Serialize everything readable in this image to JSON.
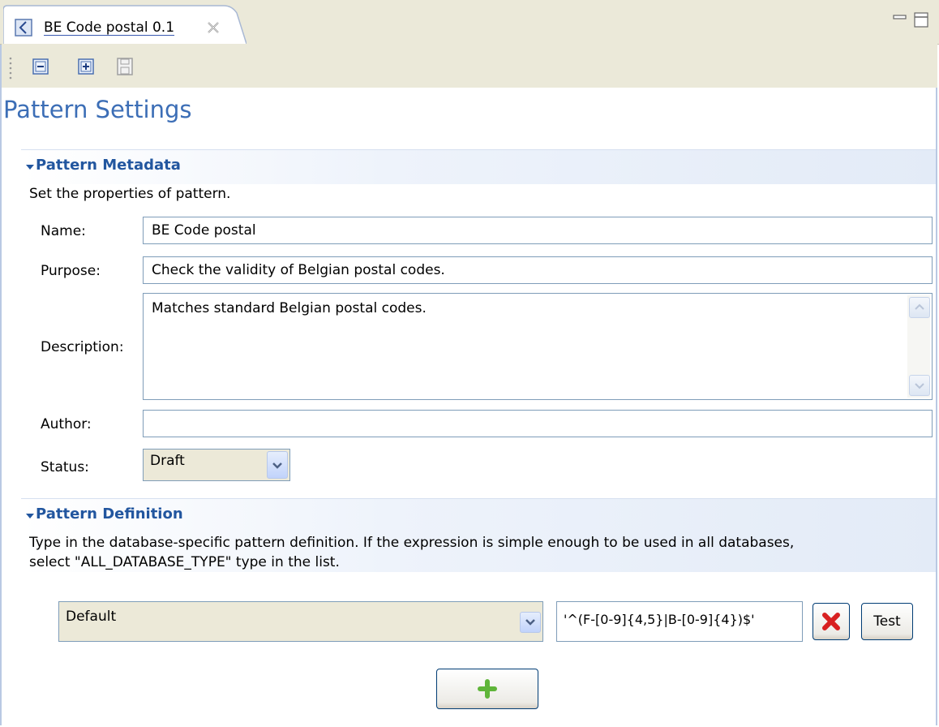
{
  "window": {
    "tab_title": "BE Code postal 0.1",
    "icons": [
      "pattern-file-icon",
      "close-icon",
      "minimize-icon",
      "maximize-icon"
    ]
  },
  "toolbar": {
    "icons": [
      "collapse-all-icon",
      "expand-all-icon",
      "save-icon"
    ]
  },
  "page_title": "Pattern Settings",
  "metadata": {
    "section_title": "Pattern Metadata",
    "description": "Set the properties of pattern.",
    "name_label": "Name:",
    "name_value": "BE Code postal",
    "purpose_label": "Purpose:",
    "purpose_value": "Check the validity of Belgian postal codes.",
    "description_label": "Description:",
    "description_value": "Matches standard Belgian postal codes.",
    "author_label": "Author:",
    "author_value": "",
    "status_label": "Status:",
    "status_value": "Draft"
  },
  "definition": {
    "section_title": "Pattern Definition",
    "description_line1": "Type in the database-specific pattern definition. If the expression is simple enough to be used in all databases,",
    "description_line2": "select \"ALL_DATABASE_TYPE\" type in the list.",
    "database_type": "Default",
    "expression": "'^(F-[0-9]{4,5}|B-[0-9]{4})$'",
    "test_label": "Test"
  },
  "colors": {
    "title_blue": "#3c6eb6",
    "section_blue": "#22569f",
    "chrome_beige": "#ebe9d9",
    "delete_red": "#d82020",
    "add_green": "#5fb53a"
  }
}
